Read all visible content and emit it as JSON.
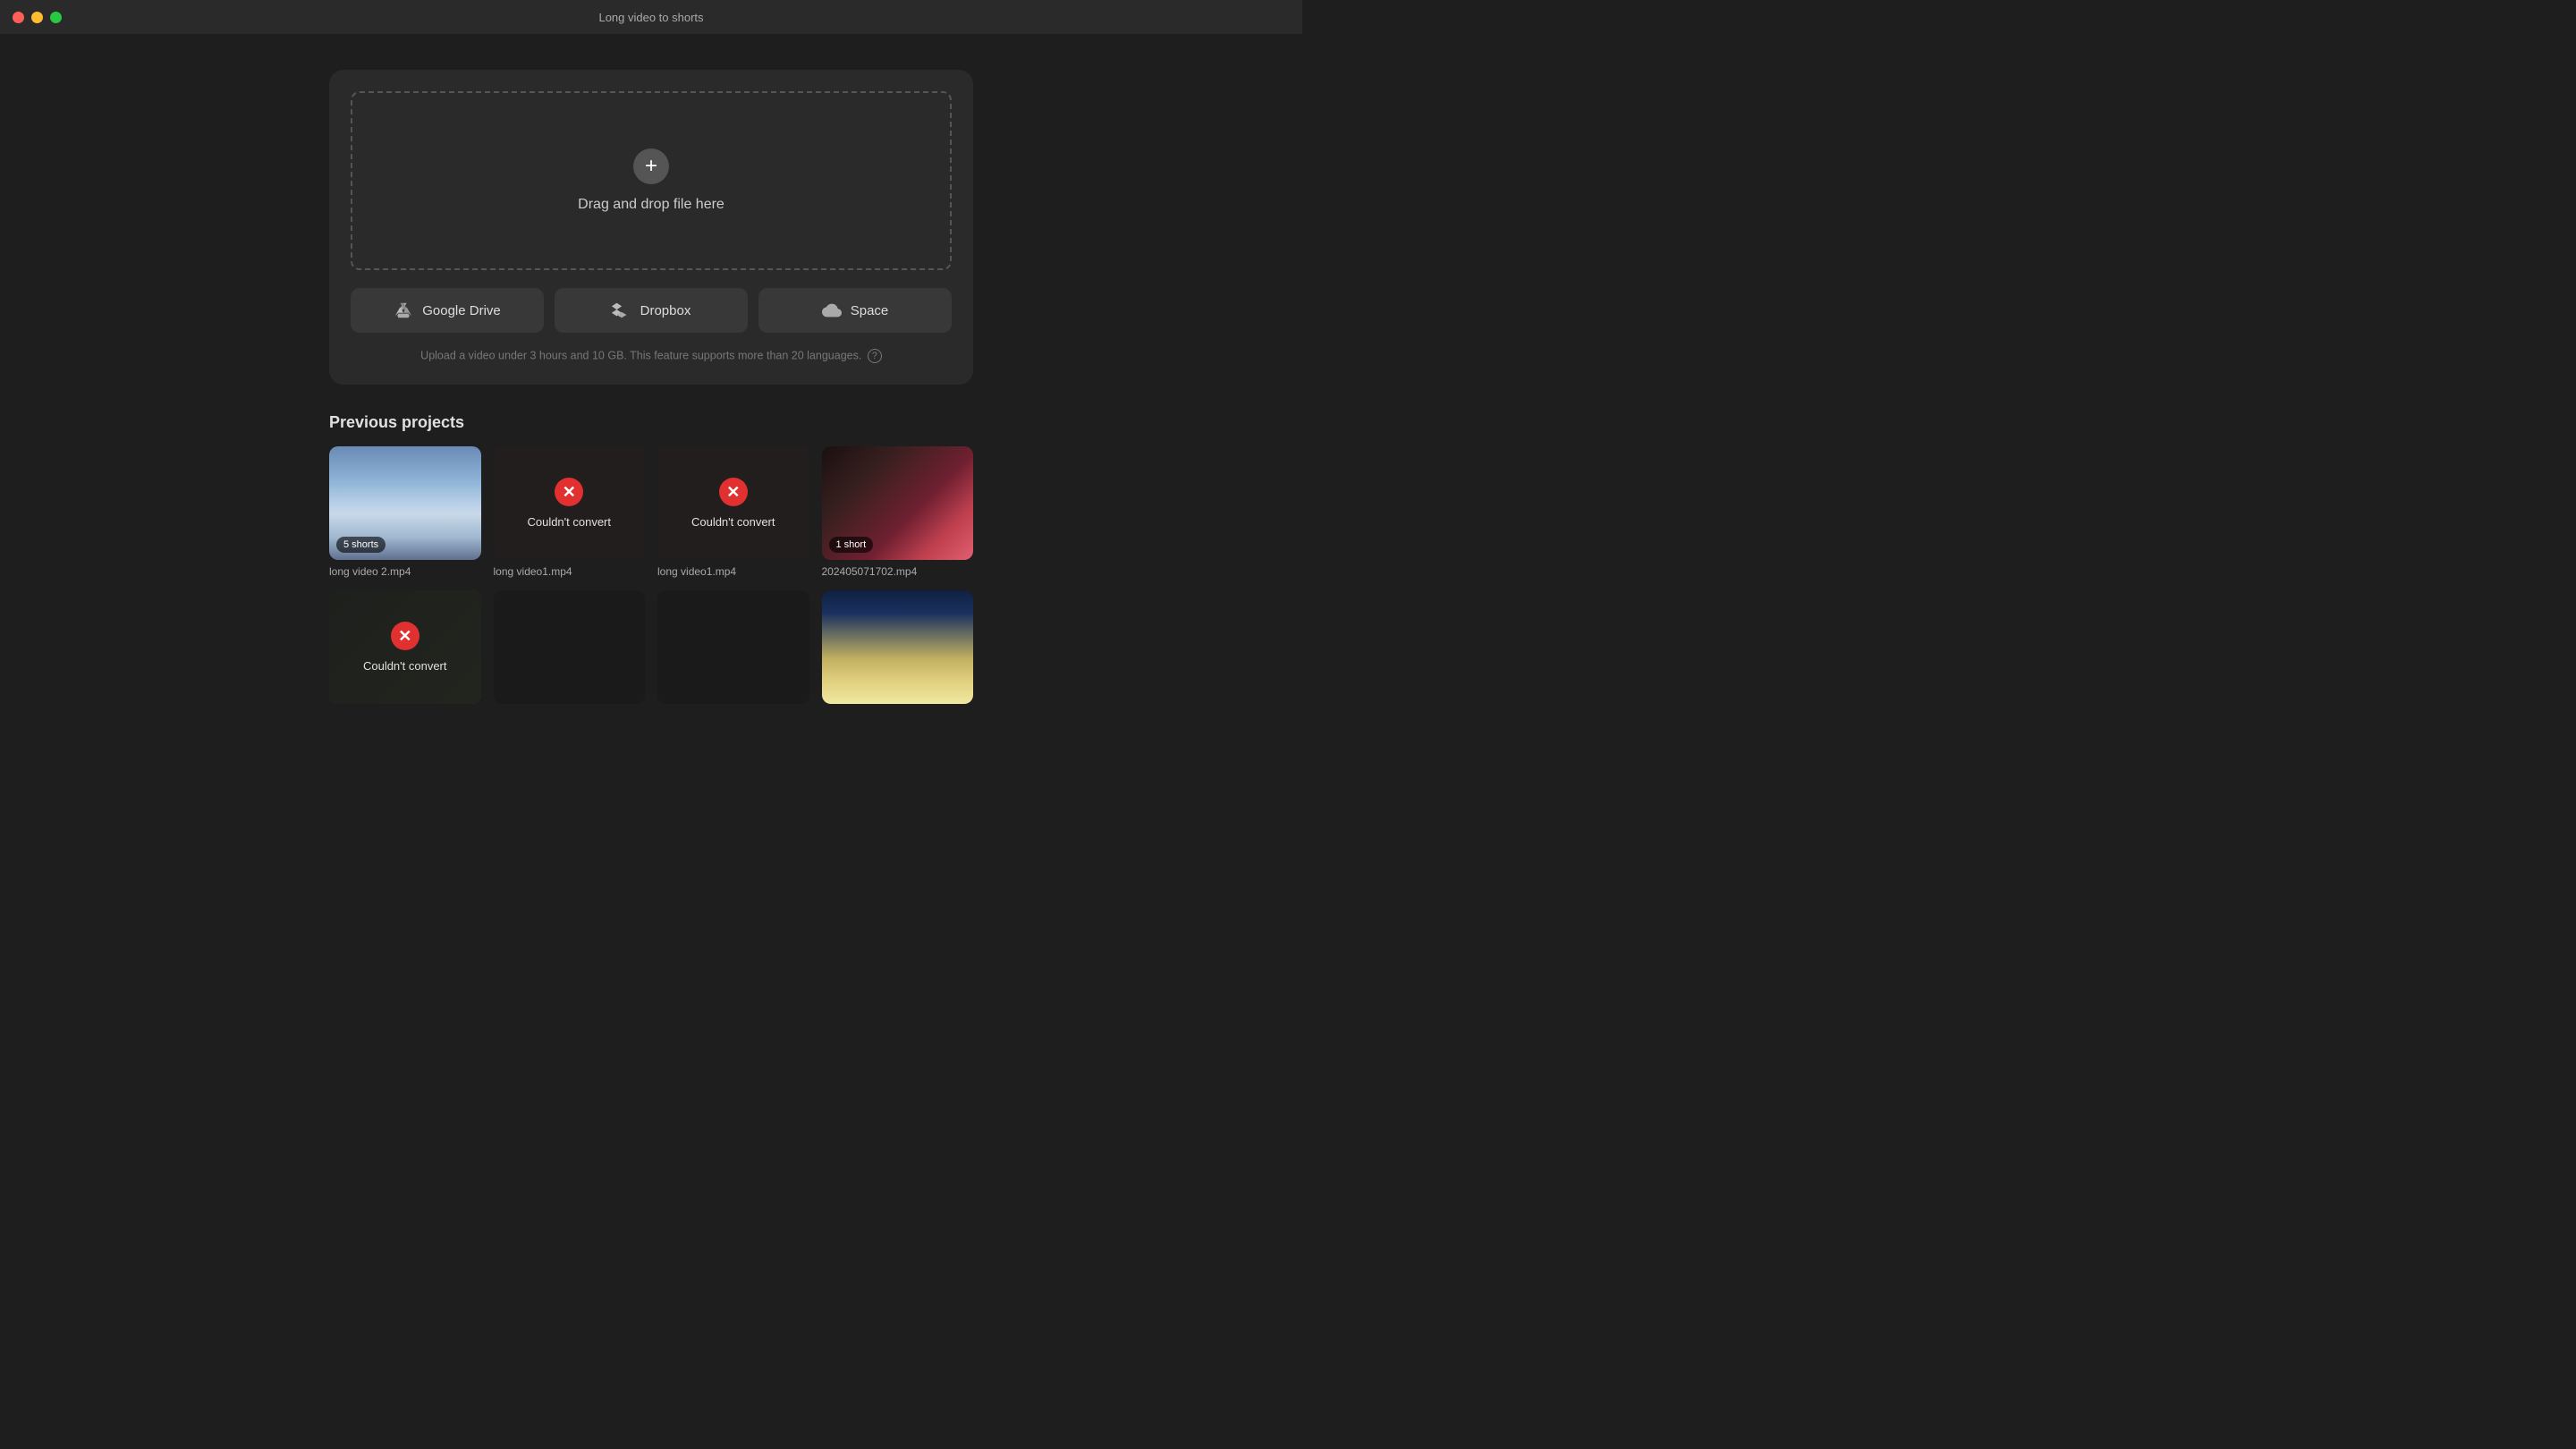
{
  "window": {
    "title": "Long video to shorts",
    "traffic_lights": {
      "close": "close",
      "minimize": "minimize",
      "maximize": "maximize"
    }
  },
  "upload": {
    "drop_zone_text": "Drag and drop file here",
    "plus_symbol": "+",
    "note": "Upload a video under 3 hours and 10 GB. This feature supports more than 20 languages.",
    "help_symbol": "?",
    "sources": [
      {
        "id": "google-drive",
        "label": "Google Drive"
      },
      {
        "id": "dropbox",
        "label": "Dropbox"
      },
      {
        "id": "space",
        "label": "Space"
      }
    ]
  },
  "previous_projects": {
    "section_title": "Previous projects",
    "projects": [
      {
        "id": "proj1",
        "name": "long video 2.mp4",
        "badge": "5 shorts",
        "status": "ok",
        "thumb_class": "thumb-mountains"
      },
      {
        "id": "proj2",
        "name": "long video1.mp4",
        "badge": null,
        "status": "error",
        "error_text": "Couldn't convert",
        "thumb_class": "thumb-fashion"
      },
      {
        "id": "proj3",
        "name": "long video1.mp4",
        "badge": null,
        "status": "error",
        "error_text": "Couldn't convert",
        "thumb_class": "thumb-fashion"
      },
      {
        "id": "proj4",
        "name": "202405071702.mp4",
        "badge": "1 short",
        "status": "ok",
        "thumb_class": "thumb-fashion"
      },
      {
        "id": "proj5",
        "name": "",
        "badge": null,
        "status": "error",
        "error_text": "Couldn't convert",
        "thumb_class": "thumb-plant"
      },
      {
        "id": "proj6",
        "name": "",
        "badge": null,
        "status": "ok",
        "thumb_class": "thumb-dark"
      },
      {
        "id": "proj7",
        "name": "",
        "badge": null,
        "status": "ok",
        "thumb_class": "thumb-dark"
      },
      {
        "id": "proj8",
        "name": "",
        "badge": null,
        "status": "ok",
        "thumb_class": "thumb-sky"
      }
    ]
  },
  "icons": {
    "close_x": "✕",
    "error_x": "✕"
  }
}
